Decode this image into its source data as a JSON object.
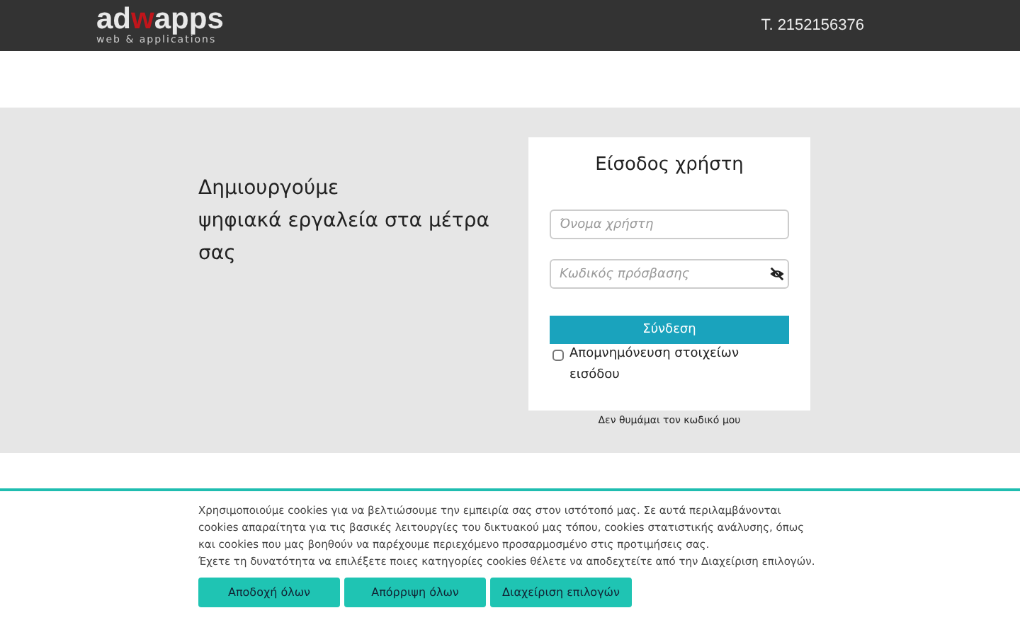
{
  "header": {
    "logo": {
      "start": "ad",
      "mark": "w",
      "end": "apps",
      "tagline": "web & applications"
    },
    "phone": "T. 2152156376"
  },
  "hero": {
    "lines": [
      "Δημιουργούμε",
      "ψηφιακά εργαλεία στα μέτρα σας"
    ]
  },
  "login": {
    "title": "Είσοδος χρήστη",
    "username": {
      "placeholder": "Όνομα χρήστη"
    },
    "password": {
      "placeholder": "Κωδικός πρόσβασης"
    },
    "submit": "Σύνδεση",
    "remember": {
      "label": "Απομνημόνευση στοιχείων εισόδου",
      "checked": false
    },
    "forgot": "Δεν θυμάμαι τον κωδικό μου"
  },
  "cookies": {
    "lines": [
      "Χρησιμοποιούμε cookies για να βελτιώσουμε την εμπειρία σας στον ιστότοπό μας. Σε αυτά περιλαμβάνονται cookies απαραίτητα για τις βασικές λειτουργίες του δικτυακού μας τόπου, cookies στατιστικής ανάλυσης, όπως και cookies που μας βοηθούν να παρέχουμε περιεχόμενο προσαρμοσμένο στις προτιμήσεις σας.",
      "Έχετε τη δυνατότητα να επιλέξετε ποιες κατηγορίες cookies θέλετε να αποδεχτείτε από την Διαχείριση επιλογών."
    ],
    "buttons": [
      "Αποδοχή όλων",
      "Απόρριψη όλων",
      "Διαχείριση επιλογών"
    ]
  }
}
